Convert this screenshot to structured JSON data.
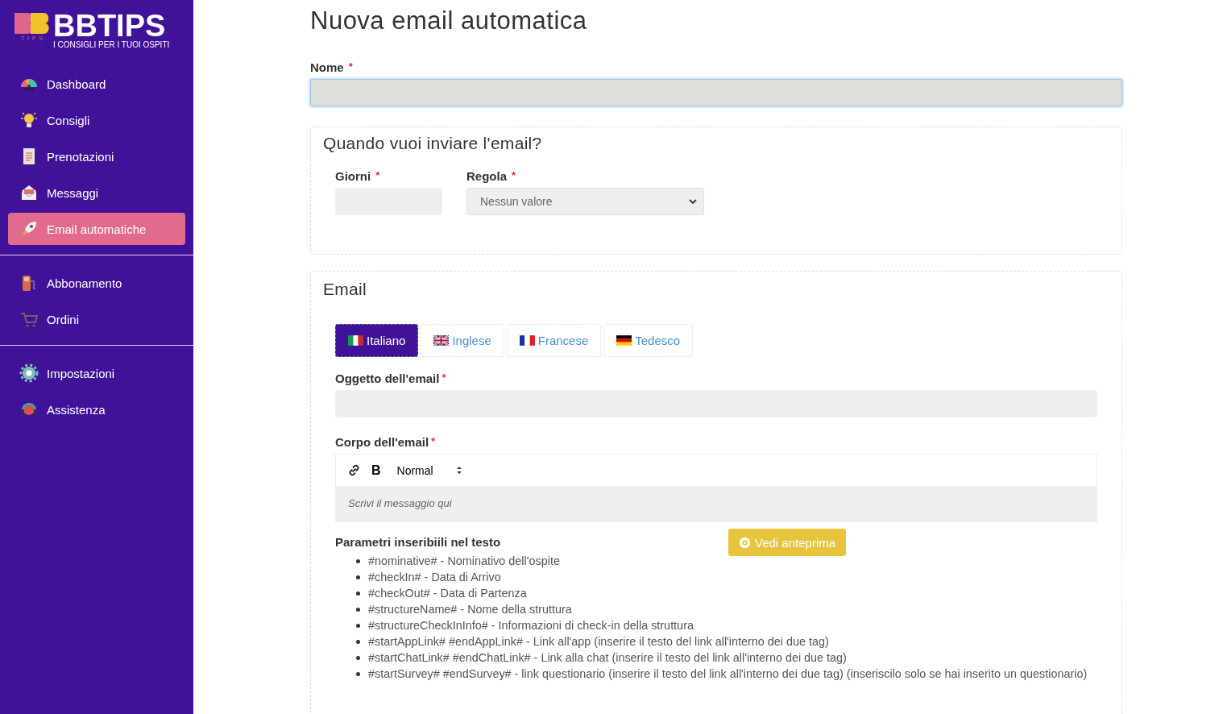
{
  "logo": {
    "title": "BBTIPS",
    "caption": "T I P S",
    "tagline": "I CONSIGLI PER I TUOI OSPITI"
  },
  "sidebar": {
    "groups": [
      [
        {
          "label": "Dashboard",
          "selected": false
        },
        {
          "label": "Consigli",
          "selected": false
        },
        {
          "label": "Prenotazioni",
          "selected": false
        },
        {
          "label": "Messaggi",
          "selected": false
        },
        {
          "label": "Email automatiche",
          "selected": true
        }
      ],
      [
        {
          "label": "Abbonamento",
          "selected": false
        },
        {
          "label": "Ordini",
          "selected": false
        }
      ],
      [
        {
          "label": "Impostazioni",
          "selected": false
        },
        {
          "label": "Assistenza",
          "selected": false
        }
      ]
    ]
  },
  "page_title": "Nuova email automatica",
  "name_field": {
    "label": "Nome",
    "required_mark": "*",
    "focused": true
  },
  "schedule": {
    "title": "Quando vuoi inviare l'email?",
    "days": {
      "label": "Giorni",
      "required_mark": "*"
    },
    "rule": {
      "label": "Regola",
      "required_mark": "*",
      "value": "Nessun valore"
    }
  },
  "email": {
    "title": "Email",
    "tabs": [
      {
        "label": "Italiano",
        "selected": true
      },
      {
        "label": "Inglese",
        "selected": false
      },
      {
        "label": "Francese",
        "selected": false
      },
      {
        "label": "Tedesco",
        "selected": false
      }
    ],
    "subject": {
      "label": "Oggetto dell'email",
      "required_mark": "*"
    },
    "body": {
      "label": "Corpo dell'email",
      "required_mark": "*",
      "bold_button": "B",
      "format": "Normal",
      "placeholder": "Scrivi il messaggio qui"
    },
    "params": {
      "title": "Parametri inseribiili nel testo",
      "items": [
        "#nominative# - Nominativo dell'ospite",
        "#checkIn# - Data di Arrivo",
        "#checkOut# - Data di Partenza",
        "#structureName# - Nome della struttura",
        "#structureCheckInInfo# - Informazioni di check-in della struttura",
        "#startAppLink# #endAppLink# - Link all'app (inserire il testo del link all'interno dei due tag)",
        "#startChatLink# #endChatLink# - Link alla chat (inserire il testo del link all'interno dei due tag)",
        "#startSurvey# #endSurvey# - link questionario (inserire il testo del link all'interno dei due tag) (inseriscilo solo se hai inserito un questionario)"
      ]
    },
    "preview_button": "Vedi anteprima"
  }
}
